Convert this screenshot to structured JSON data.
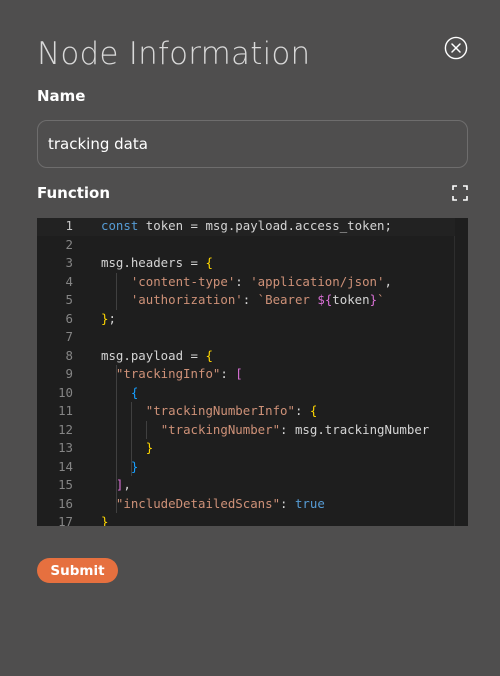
{
  "dialog": {
    "title": "Node Information"
  },
  "name_field": {
    "label": "Name",
    "value": "tracking data"
  },
  "function_field": {
    "label": "Function"
  },
  "code": {
    "lines": [
      {
        "n": "1",
        "tokens": [
          [
            "kw",
            "const"
          ],
          [
            "plain",
            " token = msg.payload.access_token;"
          ]
        ]
      },
      {
        "n": "2",
        "tokens": []
      },
      {
        "n": "3",
        "tokens": [
          [
            "plain",
            "msg.headers = "
          ],
          [
            "b1",
            "{"
          ]
        ]
      },
      {
        "n": "4",
        "tokens": [
          [
            "plain",
            "    "
          ],
          [
            "str",
            "'content-type'"
          ],
          [
            "plain",
            ": "
          ],
          [
            "str",
            "'application/json'"
          ],
          [
            "plain",
            ","
          ]
        ]
      },
      {
        "n": "5",
        "tokens": [
          [
            "plain",
            "    "
          ],
          [
            "str",
            "'authorization'"
          ],
          [
            "plain",
            ": "
          ],
          [
            "str",
            "`Bearer "
          ],
          [
            "b2",
            "${"
          ],
          [
            "plain",
            "token"
          ],
          [
            "b2",
            "}"
          ],
          [
            "str",
            "`"
          ]
        ]
      },
      {
        "n": "6",
        "tokens": [
          [
            "b1",
            "}"
          ],
          [
            "plain",
            ";"
          ]
        ]
      },
      {
        "n": "7",
        "tokens": []
      },
      {
        "n": "8",
        "tokens": [
          [
            "plain",
            "msg.payload = "
          ],
          [
            "b1",
            "{"
          ]
        ]
      },
      {
        "n": "9",
        "tokens": [
          [
            "plain",
            "  "
          ],
          [
            "str",
            "\"trackingInfo\""
          ],
          [
            "plain",
            ": "
          ],
          [
            "b2",
            "["
          ]
        ]
      },
      {
        "n": "10",
        "tokens": [
          [
            "plain",
            "    "
          ],
          [
            "b3",
            "{"
          ]
        ]
      },
      {
        "n": "11",
        "tokens": [
          [
            "plain",
            "      "
          ],
          [
            "str",
            "\"trackingNumberInfo\""
          ],
          [
            "plain",
            ": "
          ],
          [
            "b1",
            "{"
          ]
        ]
      },
      {
        "n": "12",
        "tokens": [
          [
            "plain",
            "        "
          ],
          [
            "str",
            "\"trackingNumber\""
          ],
          [
            "plain",
            ": msg.trackingNumber"
          ]
        ]
      },
      {
        "n": "13",
        "tokens": [
          [
            "plain",
            "      "
          ],
          [
            "b1",
            "}"
          ]
        ]
      },
      {
        "n": "14",
        "tokens": [
          [
            "plain",
            "    "
          ],
          [
            "b3",
            "}"
          ]
        ]
      },
      {
        "n": "15",
        "tokens": [
          [
            "plain",
            "  "
          ],
          [
            "b2",
            "]"
          ],
          [
            "plain",
            ","
          ]
        ]
      },
      {
        "n": "16",
        "tokens": [
          [
            "plain",
            "  "
          ],
          [
            "str",
            "\"includeDetailedScans\""
          ],
          [
            "plain",
            ": "
          ],
          [
            "bool",
            "true"
          ]
        ]
      },
      {
        "n": "17",
        "tokens": [
          [
            "b1",
            "}"
          ]
        ]
      }
    ],
    "current_line": 1
  },
  "actions": {
    "submit_label": "Submit"
  },
  "icons": {
    "close": "close-circle-icon",
    "expand": "fullscreen-expand-icon"
  },
  "colors": {
    "background": "#4f4e4e",
    "editor_background": "#1e1e1e",
    "submit_button": "#e6703f"
  }
}
